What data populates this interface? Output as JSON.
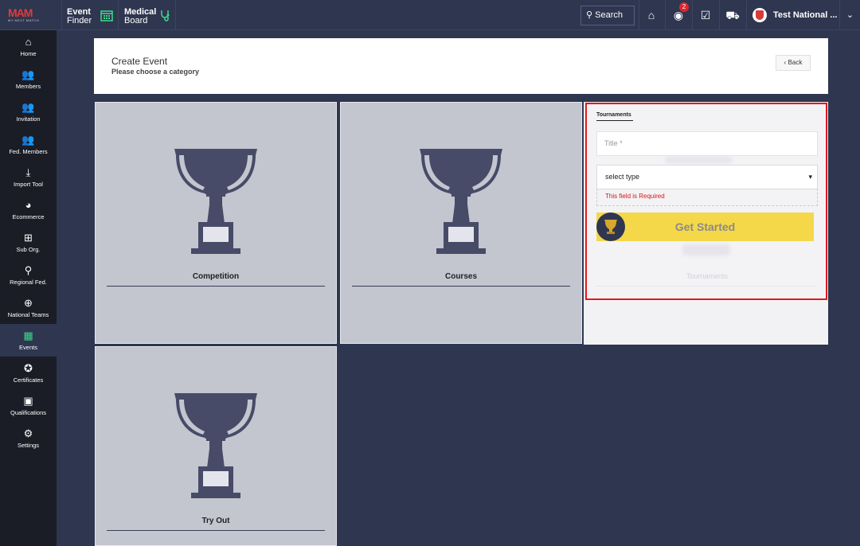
{
  "topbar": {
    "logo_text": "MAM",
    "logo_tagline": "MY NEXT MATCH",
    "event_finder": {
      "line1": "Event",
      "line2": "Finder",
      "icon": "calendar-icon"
    },
    "medical_board": {
      "line1": "Medical",
      "line2": "Board",
      "icon": "stethoscope-icon"
    },
    "search_label": "Search",
    "notification_count": "2",
    "user_name": "Test National ...",
    "accent": "#3dd88a"
  },
  "sidebar": {
    "items": [
      {
        "label": "Home",
        "icon": "home-icon",
        "glyph": "⌂"
      },
      {
        "label": "Members",
        "icon": "members-icon",
        "glyph": "👥"
      },
      {
        "label": "Invitation",
        "icon": "invitation-icon",
        "glyph": "👥"
      },
      {
        "label": "Fed. Members",
        "icon": "fed-members-icon",
        "glyph": "👥"
      },
      {
        "label": "Import Tool",
        "icon": "import-icon",
        "glyph": "⤓"
      },
      {
        "label": "Ecommerce",
        "icon": "ecommerce-icon",
        "glyph": "◕"
      },
      {
        "label": "Sub Org.",
        "icon": "sub-org-icon",
        "glyph": "⊞"
      },
      {
        "label": "Regional Fed.",
        "icon": "regional-icon",
        "glyph": "⚲"
      },
      {
        "label": "National Teams",
        "icon": "globe-icon",
        "glyph": "⊕"
      },
      {
        "label": "Events",
        "icon": "events-icon",
        "glyph": "▦"
      },
      {
        "label": "Certificates",
        "icon": "certificates-icon",
        "glyph": "✪"
      },
      {
        "label": "Qualifications",
        "icon": "qualifications-icon",
        "glyph": "▣"
      },
      {
        "label": "Settings",
        "icon": "settings-icon",
        "glyph": "⚙"
      }
    ],
    "active": "Events"
  },
  "header": {
    "title": "Create Event",
    "subtitle": "Please choose a category",
    "back_label": "‹ Back"
  },
  "categories": [
    {
      "label": "Competition"
    },
    {
      "label": "Courses"
    },
    {
      "label": "Try Out"
    }
  ],
  "tournament_form": {
    "tab_label": "Tournaments",
    "title_placeholder": "Title *",
    "select_value": "select type",
    "error_text": "This field is Required",
    "cta_label": "Get Started",
    "ghost_label": "Tournaments",
    "cta_color": "#f4d84a",
    "error_color": "#e01b1b"
  }
}
